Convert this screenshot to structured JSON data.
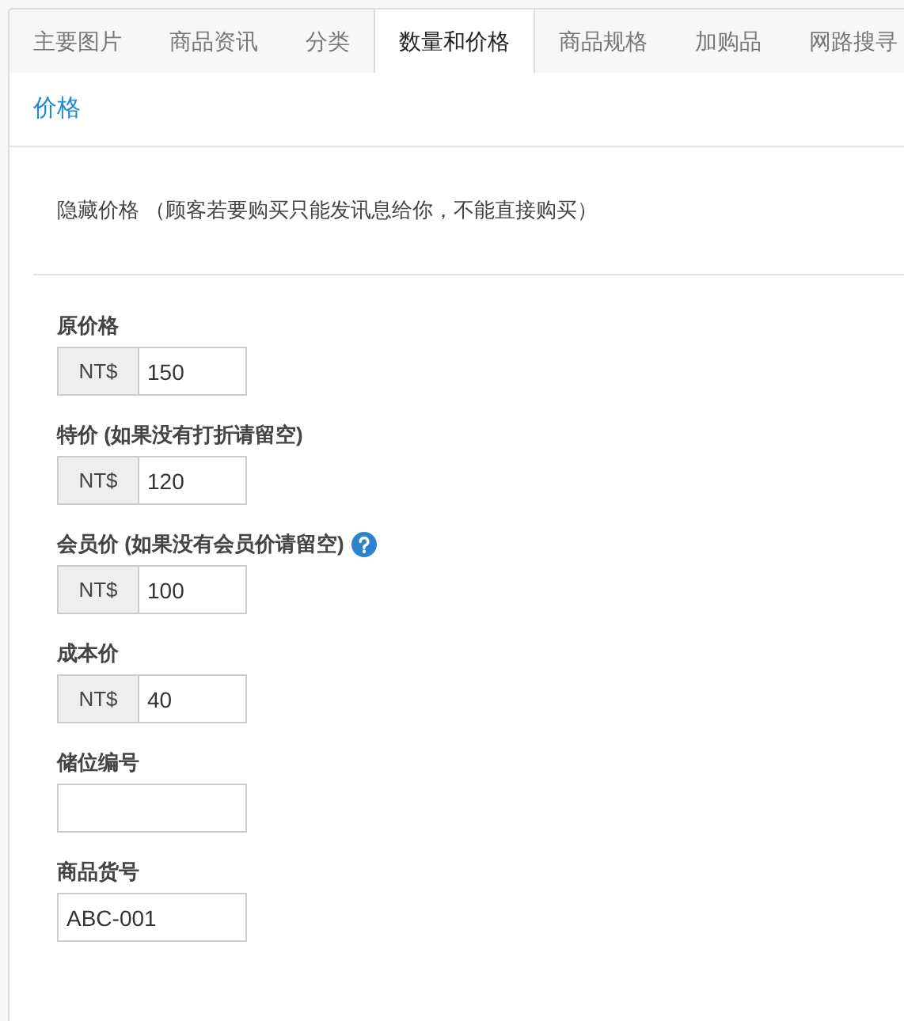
{
  "tabs": [
    {
      "label": "主要图片",
      "selected": false
    },
    {
      "label": "商品资讯",
      "selected": false
    },
    {
      "label": "分类",
      "selected": false
    },
    {
      "label": "数量和价格",
      "selected": true
    },
    {
      "label": "商品规格",
      "selected": false
    },
    {
      "label": "加购品",
      "selected": false
    },
    {
      "label": "网路搜寻",
      "selected": false
    }
  ],
  "section_title": "价格",
  "hide_price_note": "隐藏价格 （顾客若要购买只能发讯息给你，不能直接购买）",
  "fields": [
    {
      "kind": "currency",
      "label": "原价格",
      "prefix": "NT$",
      "value": "150",
      "help": false
    },
    {
      "kind": "currency",
      "label": "特价 (如果没有打折请留空)",
      "prefix": "NT$",
      "value": "120",
      "help": false
    },
    {
      "kind": "currency",
      "label": "会员价 (如果没有会员价请留空)",
      "prefix": "NT$",
      "value": "100",
      "help": true
    },
    {
      "kind": "currency",
      "label": "成本价",
      "prefix": "NT$",
      "value": "40",
      "help": false
    },
    {
      "kind": "plain",
      "label": "储位编号"
    },
    {
      "kind": "plain",
      "label": "商品货号",
      "value": "ABC-001"
    }
  ]
}
